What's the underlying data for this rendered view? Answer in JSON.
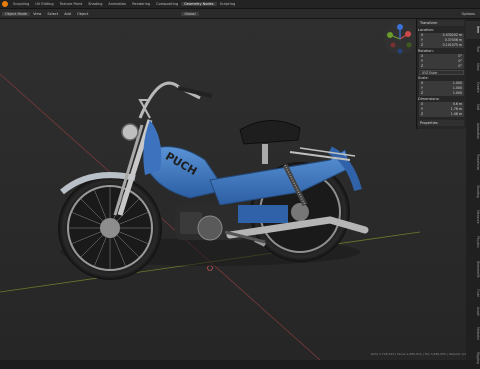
{
  "topbar": {
    "workspaces": [
      "Sculpting",
      "UV Editing",
      "Texture Paint",
      "Shading",
      "Animation",
      "Rendering",
      "Compositing",
      "Geometry Nodes",
      "Scripting"
    ],
    "active_index": 7
  },
  "header": {
    "mode": "Object Mode",
    "items": [
      "View",
      "Select",
      "Add",
      "Object"
    ],
    "transform": "Global",
    "options": "Options"
  },
  "npanel": {
    "section": "Transform",
    "location_label": "Location:",
    "location": [
      {
        "axis": "X",
        "value": "0.030202 m"
      },
      {
        "axis": "Y",
        "value": "0.37456 m"
      },
      {
        "axis": "Z",
        "value": "0.101075 m"
      }
    ],
    "rotation_label": "Rotation:",
    "rotation": [
      {
        "axis": "X",
        "value": "0°"
      },
      {
        "axis": "Y",
        "value": "0°"
      },
      {
        "axis": "Z",
        "value": "0°"
      }
    ],
    "rotation_mode": "XYZ Euler",
    "scale_label": "Scale:",
    "scale": [
      {
        "axis": "X",
        "value": "1.000"
      },
      {
        "axis": "Y",
        "value": "1.000"
      },
      {
        "axis": "Z",
        "value": "1.000"
      }
    ],
    "dimensions_label": "Dimensions:",
    "dimensions": [
      {
        "axis": "X",
        "value": "0.6 m"
      },
      {
        "axis": "Y",
        "value": "1.76 m"
      },
      {
        "axis": "Z",
        "value": "1.08 m"
      }
    ],
    "properties": "Properties"
  },
  "side_tabs": [
    "Item",
    "Tool",
    "View",
    "Create",
    "Edit",
    "Animation",
    "Transform",
    "Shading",
    "Measure",
    "Physics",
    "BlenderKit",
    "Fluid",
    "Asset",
    "Material",
    "Rigging",
    "Misc"
  ],
  "active_tab": "Item",
  "tank_label": "PUCH",
  "status": "Verts 1,726,543 | Faces 1,680,012 | Tris 3,360,050 | Objects 1/1"
}
